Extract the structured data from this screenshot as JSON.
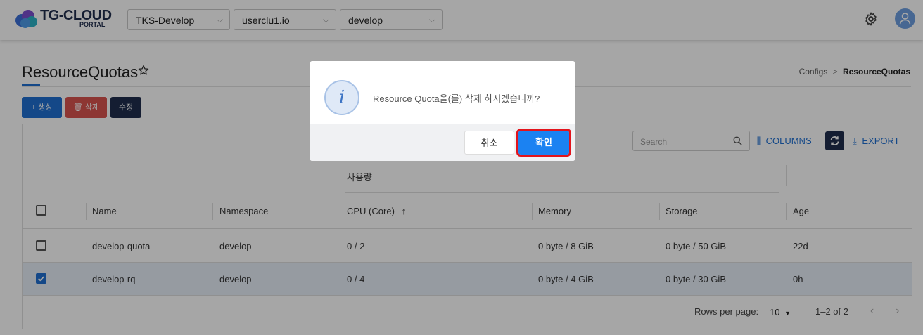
{
  "header": {
    "logo_title": "TG-CLOUD",
    "logo_sub": "PORTAL",
    "selects": [
      {
        "value": "TKS-Develop"
      },
      {
        "value": "userclu1.io"
      },
      {
        "value": "develop"
      }
    ],
    "settings_icon": "gear-icon",
    "avatar_icon": "user-icon"
  },
  "page": {
    "title": "ResourceQuotas",
    "breadcrumb": {
      "parent": "Configs",
      "separator": ">",
      "current": "ResourceQuotas"
    }
  },
  "actions": {
    "create_label": "+ 생성",
    "delete_label": "삭제",
    "edit_label": "수정"
  },
  "toolbar": {
    "search_placeholder": "Search",
    "columns_label": "COLUMNS",
    "export_label": "EXPORT"
  },
  "table": {
    "group_header": "사용량",
    "columns": [
      "Name",
      "Namespace",
      "CPU (Core)",
      "Memory",
      "Storage",
      "Age"
    ],
    "sort_indicator": "↑",
    "rows": [
      {
        "name": "develop-quota",
        "namespace": "develop",
        "cpu": "0 / 2",
        "memory": "0 byte / 8 GiB",
        "storage": "0 byte / 50 GiB",
        "age": "22d",
        "checked": false
      },
      {
        "name": "develop-rq",
        "namespace": "develop",
        "cpu": "0 / 4",
        "memory": "0 byte / 4 GiB",
        "storage": "0 byte / 30 GiB",
        "age": "0h",
        "checked": true
      }
    ]
  },
  "pagination": {
    "rows_per_page_label": "Rows per page:",
    "rows_per_page_value": "10",
    "range_text": "1–2 of 2"
  },
  "dialog": {
    "message": "Resource Quota을(를) 삭제 하시겠습니까?",
    "cancel_label": "취소",
    "confirm_label": "확인"
  },
  "colors": {
    "primary": "#1f6fd1",
    "danger": "#d9534f",
    "navy": "#1f2d4d",
    "confirm": "#1b82f2",
    "highlight": "#e3141c"
  }
}
